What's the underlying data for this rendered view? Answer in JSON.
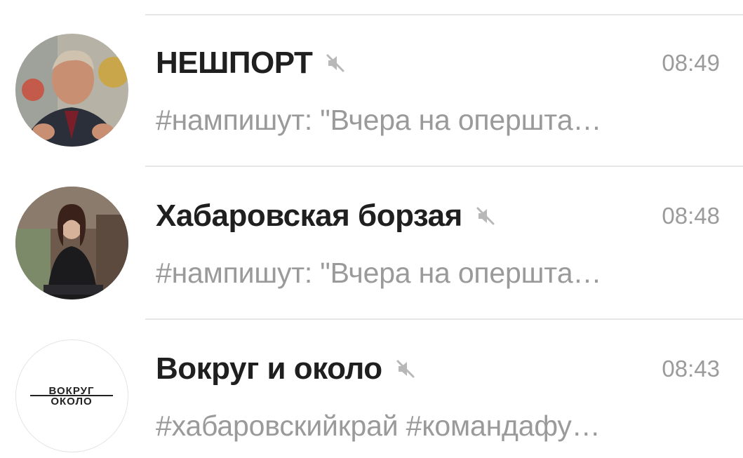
{
  "chats": [
    {
      "name": "НЕШПОРТ",
      "time": "08:49",
      "preview": "#нампишут:  \"Вчера на оперштa…",
      "muted": true,
      "avatar": "person-photo-avatar"
    },
    {
      "name": "Хабаровская борзая",
      "time": "08:48",
      "preview": "#нампишут:  \"Вчера на оперштa…",
      "muted": true,
      "avatar": "person-photo-avatar"
    },
    {
      "name": "Вокруг и около",
      "time": "08:43",
      "preview": "#хабаровскийкрай #командафу…",
      "muted": true,
      "avatar": "logo-avatar",
      "avatar_logo_text": "ВОКРУГ ОКОЛО"
    }
  ],
  "colors": {
    "name": "#1f1f1f",
    "secondary": "#9b9b9b",
    "divider": "#e6e6e6",
    "mute_icon": "#b8b8b8"
  }
}
